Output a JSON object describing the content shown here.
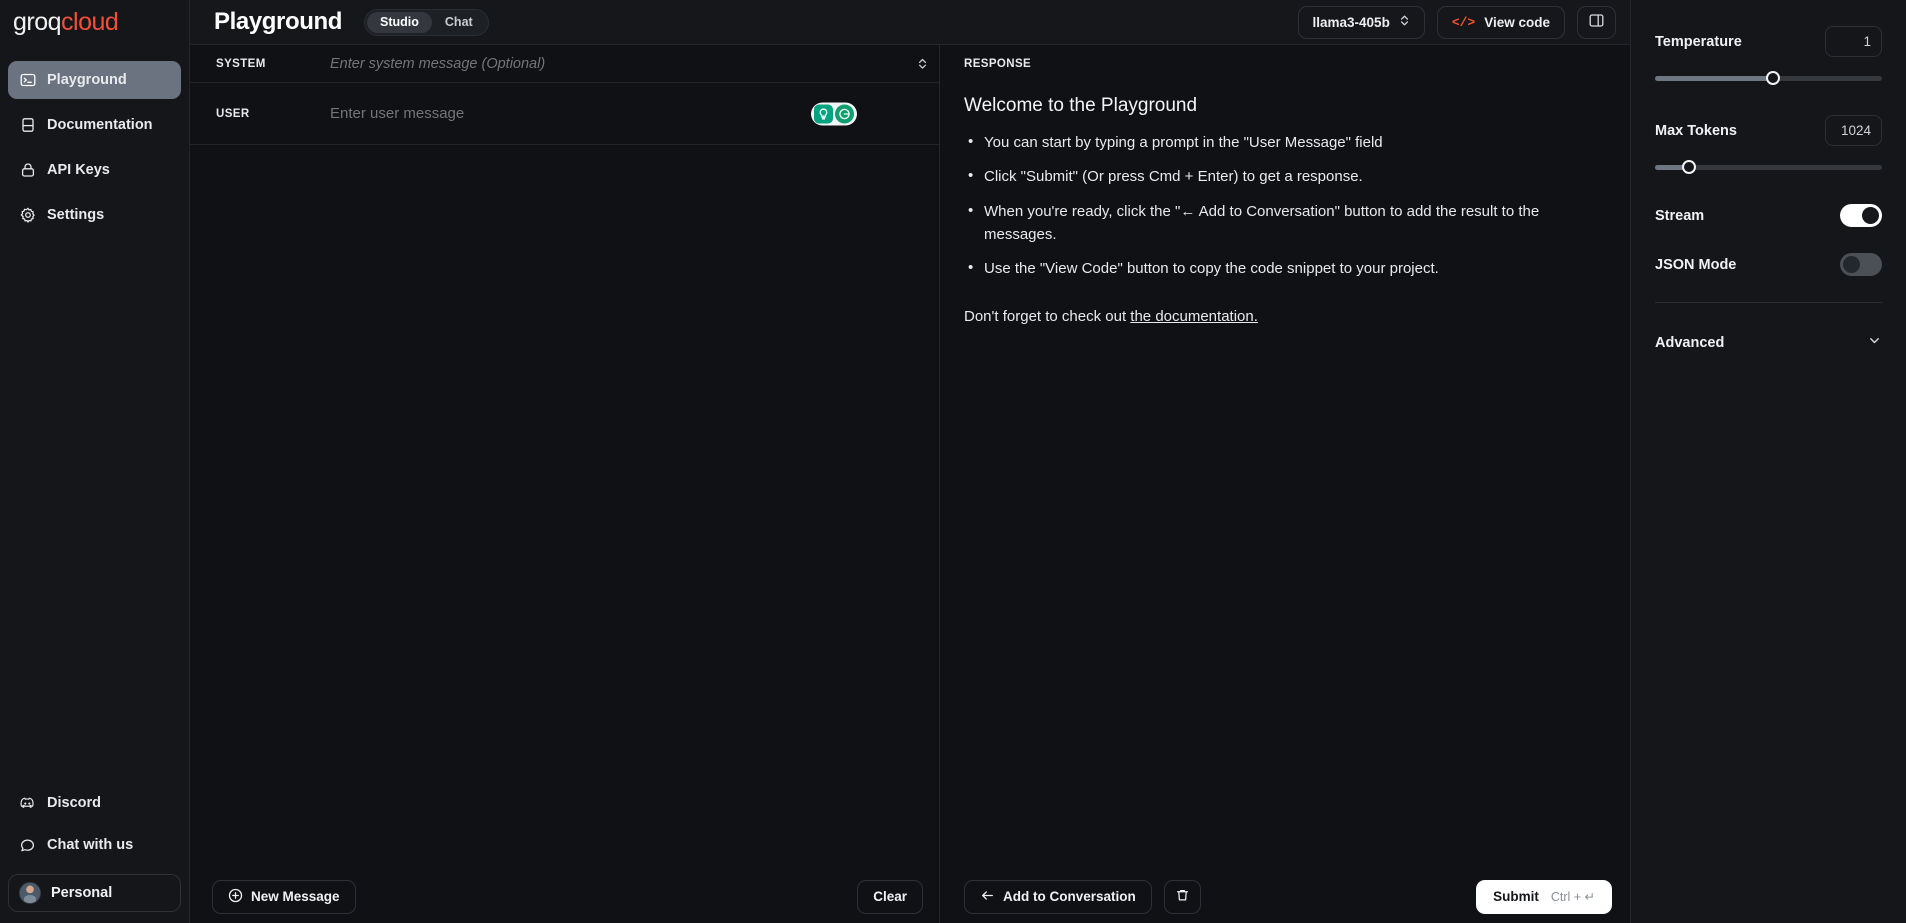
{
  "brand": {
    "first": "groq",
    "second": "cloud"
  },
  "sidebar": {
    "items": [
      {
        "label": "Playground",
        "icon": "terminal-icon"
      },
      {
        "label": "Documentation",
        "icon": "book-icon"
      },
      {
        "label": "API Keys",
        "icon": "lock-icon"
      },
      {
        "label": "Settings",
        "icon": "gear-icon"
      }
    ],
    "bottom": [
      {
        "label": "Discord",
        "icon": "discord-icon"
      },
      {
        "label": "Chat with us",
        "icon": "chat-bubble-icon"
      }
    ],
    "account": "Personal"
  },
  "header": {
    "title": "Playground",
    "tabs": [
      {
        "label": "Studio",
        "active": true
      },
      {
        "label": "Chat",
        "active": false
      }
    ],
    "model": "llama3-405b",
    "view_code": "View code",
    "panel_toggle_icon": "panel-right-icon"
  },
  "messages": {
    "system_label": "SYSTEM",
    "system_placeholder": "Enter system message (Optional)",
    "system_value": "",
    "user_label": "USER",
    "user_placeholder": "Enter user message",
    "user_value": "",
    "new_message": "New Message",
    "clear": "Clear"
  },
  "response": {
    "label": "RESPONSE",
    "title": "Welcome to the Playground",
    "bullets": [
      "You can start by typing a prompt in the \"User Message\" field",
      "Click \"Submit\" (Or press Cmd + Enter) to get a response.",
      "When you're ready, click the \"←  Add to Conversation\" button to add the result to the messages.",
      "Use the \"View Code\" button to copy the code snippet to your project."
    ],
    "footer_prefix": "Don't forget to check out ",
    "footer_link": "the documentation.",
    "add_to_conversation": "Add to Conversation",
    "delete_icon": "trash-icon",
    "submit": "Submit",
    "submit_hint": "Ctrl + ↵"
  },
  "settings": {
    "temperature": {
      "label": "Temperature",
      "value": "1",
      "percent": 52
    },
    "max_tokens": {
      "label": "Max Tokens",
      "value": "1024",
      "percent": 15
    },
    "stream": {
      "label": "Stream",
      "on": true
    },
    "json_mode": {
      "label": "JSON Mode",
      "on": false
    },
    "advanced": {
      "label": "Advanced",
      "icon": "chevron-down-icon"
    }
  },
  "colors": {
    "accent": "#f55036",
    "active_nav": "#6b7280",
    "panel_bg": "#141619"
  }
}
